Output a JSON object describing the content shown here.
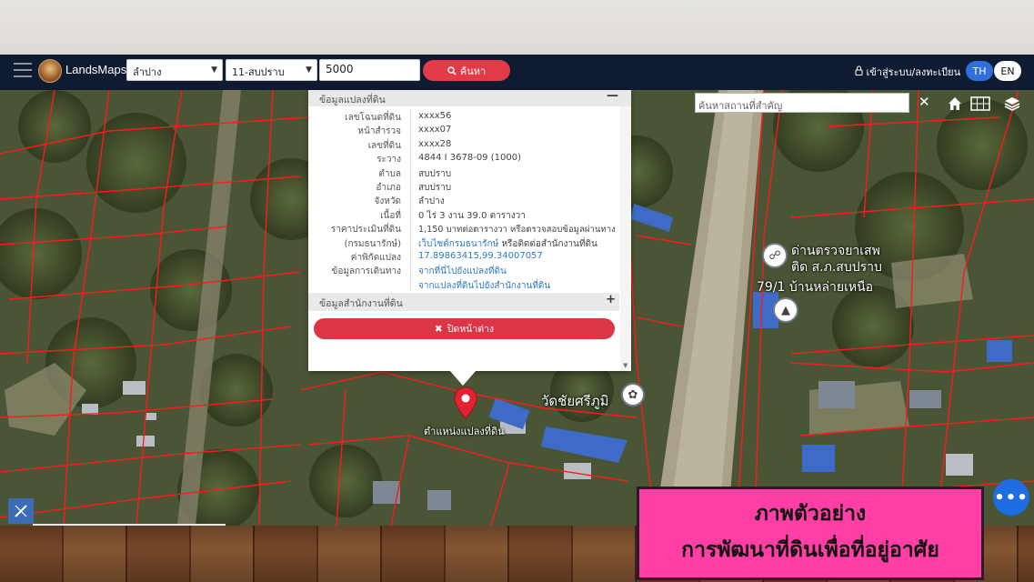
{
  "navbar": {
    "brand": "LandsMaps",
    "province": "ลำปาง",
    "district": "11-สบปราบ",
    "parcel_number": "5000",
    "search_label": "ค้นหา",
    "login_label": "เข้าสู่ระบบ/ลงทะเบียน",
    "lang_th": "TH",
    "lang_en": "EN"
  },
  "popup": {
    "section_title": "ข้อมูลแปลงที่ดิน",
    "rows": [
      {
        "label": "เลขโฉนดที่ดิน",
        "value": "xxxx56"
      },
      {
        "label": "หน้าสำรวจ",
        "value": "xxxx07"
      },
      {
        "label": "เลขที่ดิน",
        "value": "xxxx28"
      },
      {
        "label": "ระวาง",
        "value": "4844 I 3678-09 (1000)"
      },
      {
        "label": "ตำบล",
        "value": "สบปราบ"
      },
      {
        "label": "อำเภอ",
        "value": "สบปราบ"
      },
      {
        "label": "จังหวัด",
        "value": "ลำปาง"
      },
      {
        "label": "เนื้อที่",
        "value": "0 ไร่ 3 งาน 39.0 ตารางวา"
      },
      {
        "label": "ราคาประเมินที่ดิน",
        "value": "1,150 บาทต่อตารางวา หรือตรวจสอบข้อมูลผ่านทาง"
      },
      {
        "label": "(กรมธนารักษ์)",
        "value": "เว็บไซต์กรมธนารักษ์",
        "value2": "หรือติดต่อสำนักงานที่ดิน"
      },
      {
        "label": "ค่าพิกัดแปลง",
        "value": "17.89863415,99.34007057"
      },
      {
        "label": "ข้อมูลการเดินทาง",
        "value": "จากที่นี่ไปยังแปลงที่ดิน"
      },
      {
        "label": "",
        "value": "จากแปลงที่ดินไปยังสำนักงานที่ดิน"
      }
    ],
    "office_title": "ข้อมูลสำนักงานที่ดิน",
    "close_label": "ปิดหน้าต่าง"
  },
  "map": {
    "search_placeholder": "ค้นหาสถานที่สำคัญ",
    "marker_label": "ตำแหน่งแปลงที่ดิน",
    "temple_label": "วัดชัยศรีภูมิ",
    "poi_label_1": "ด่านตรวจยาเสพ",
    "poi_label_2": "ติด ส.ภ.สบปราบ",
    "poi_label_3": "79/1 บ้านหล่ายเหนือ"
  },
  "caption": {
    "line1": "ภาพตัวอย่าง",
    "line2": "การพัฒนาที่ดินเพื่อที่อยู่อาศัย"
  },
  "colors": {
    "navbar": "#0e1b30",
    "accent_red": "#e23a46",
    "caption_bg": "#ff3fa6",
    "parcel_line": "#ff1a1a"
  }
}
